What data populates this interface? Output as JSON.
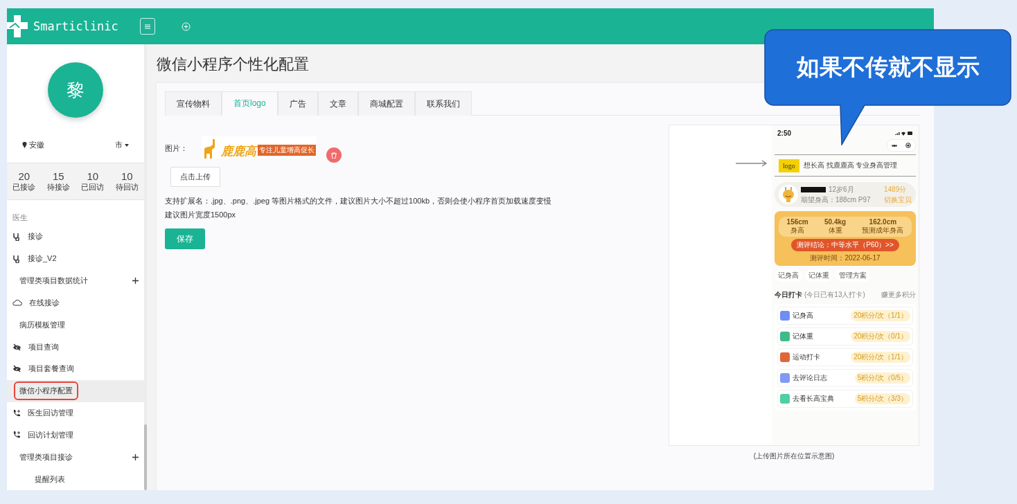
{
  "header": {
    "brand": "Smarticlinic"
  },
  "profile": {
    "avatar_letter": "黎",
    "location": "安徽",
    "location_end": "市"
  },
  "stats": [
    {
      "value": "20",
      "label": "已接诊"
    },
    {
      "value": "15",
      "label": "待接诊"
    },
    {
      "value": "10",
      "label": "已回访"
    },
    {
      "value": "10",
      "label": "待回访"
    }
  ],
  "sidebar": {
    "section": "医生",
    "items": [
      {
        "kind": "stethoscope",
        "label": "接诊",
        "selected": false
      },
      {
        "kind": "stethoscope",
        "label": "接诊_V2",
        "selected": false
      },
      {
        "kind": "group",
        "label": "管理类项目数据统计",
        "selected": false
      },
      {
        "kind": "cloud",
        "label": "在线接诊",
        "selected": false
      },
      {
        "kind": "plain",
        "label": "病历模板管理",
        "selected": false
      },
      {
        "kind": "eye",
        "label": "项目查询",
        "selected": false
      },
      {
        "kind": "eye",
        "label": "项目套餐查询",
        "selected": false
      },
      {
        "kind": "plain",
        "label": "微信小程序配置",
        "selected": true
      },
      {
        "kind": "phone",
        "label": "医生回访管理",
        "selected": false
      },
      {
        "kind": "phone",
        "label": "回访计划管理",
        "selected": false
      },
      {
        "kind": "group",
        "label": "管理类项目接诊",
        "selected": false
      },
      {
        "kind": "sub",
        "label": "提醒列表",
        "selected": false
      }
    ]
  },
  "page_title": "微信小程序个性化配置",
  "tabs": [
    {
      "label": "宣传物料",
      "selected": false
    },
    {
      "label": "首页logo",
      "selected": true
    },
    {
      "label": "广告",
      "selected": false
    },
    {
      "label": "文章",
      "selected": false
    },
    {
      "label": "商城配置",
      "selected": false
    },
    {
      "label": "联系我们",
      "selected": false
    }
  ],
  "form": {
    "image_label": "图片：",
    "logo_name": "鹿鹿高",
    "logo_tagline": "专注儿童增高促长",
    "upload_button": "点击上传",
    "hints": [
      "支持扩展名：.jpg、.png、.jpeg 等图片格式的文件，建议图片大小不超过100kb，否则会使小程序首页加载速度变慢",
      "建议图片宽度1500px"
    ],
    "save_button": "保存"
  },
  "preview": {
    "caption": "(上传图片所在位置示意图)",
    "phone": {
      "time": "2:50",
      "logo_chip": "logo",
      "slogan": "想长高 找鹿鹿高 专业身高管理",
      "child": {
        "age": "12岁6月",
        "expected": "期望身高：188cm  P97",
        "points": "1489分",
        "switch": "切换宝贝"
      },
      "measures": [
        {
          "value": "156cm",
          "label": "身高"
        },
        {
          "value": "50.4kg",
          "label": "体重"
        },
        {
          "value": "162.0cm",
          "label": "预测成年身高"
        }
      ],
      "conclusion": "测评结论：中等水平（P60）>>",
      "test_date": "测评时间：2022-06-17",
      "actions": [
        "记身高",
        "记体重",
        "管理方案"
      ],
      "checkin_title": "今日打卡",
      "checkin_note": "(今日已有13人打卡)",
      "more_points": "赚更多积分",
      "tasks": [
        {
          "label": "记身高",
          "reward": "20积分/次（1/1）",
          "color": "#6f8ef5"
        },
        {
          "label": "记体重",
          "reward": "20积分/次（0/1）",
          "color": "#3dbb8a"
        },
        {
          "label": "运动打卡",
          "reward": "20积分/次（1/1）",
          "color": "#e0663a"
        },
        {
          "label": "去评论日志",
          "reward": "5积分/次（0/5）",
          "color": "#7f9af2"
        },
        {
          "label": "去看长高宝典",
          "reward": "5积分/次（3/3）",
          "color": "#4fd0a0"
        }
      ]
    }
  },
  "callout": {
    "text": "如果不传就不显示"
  }
}
